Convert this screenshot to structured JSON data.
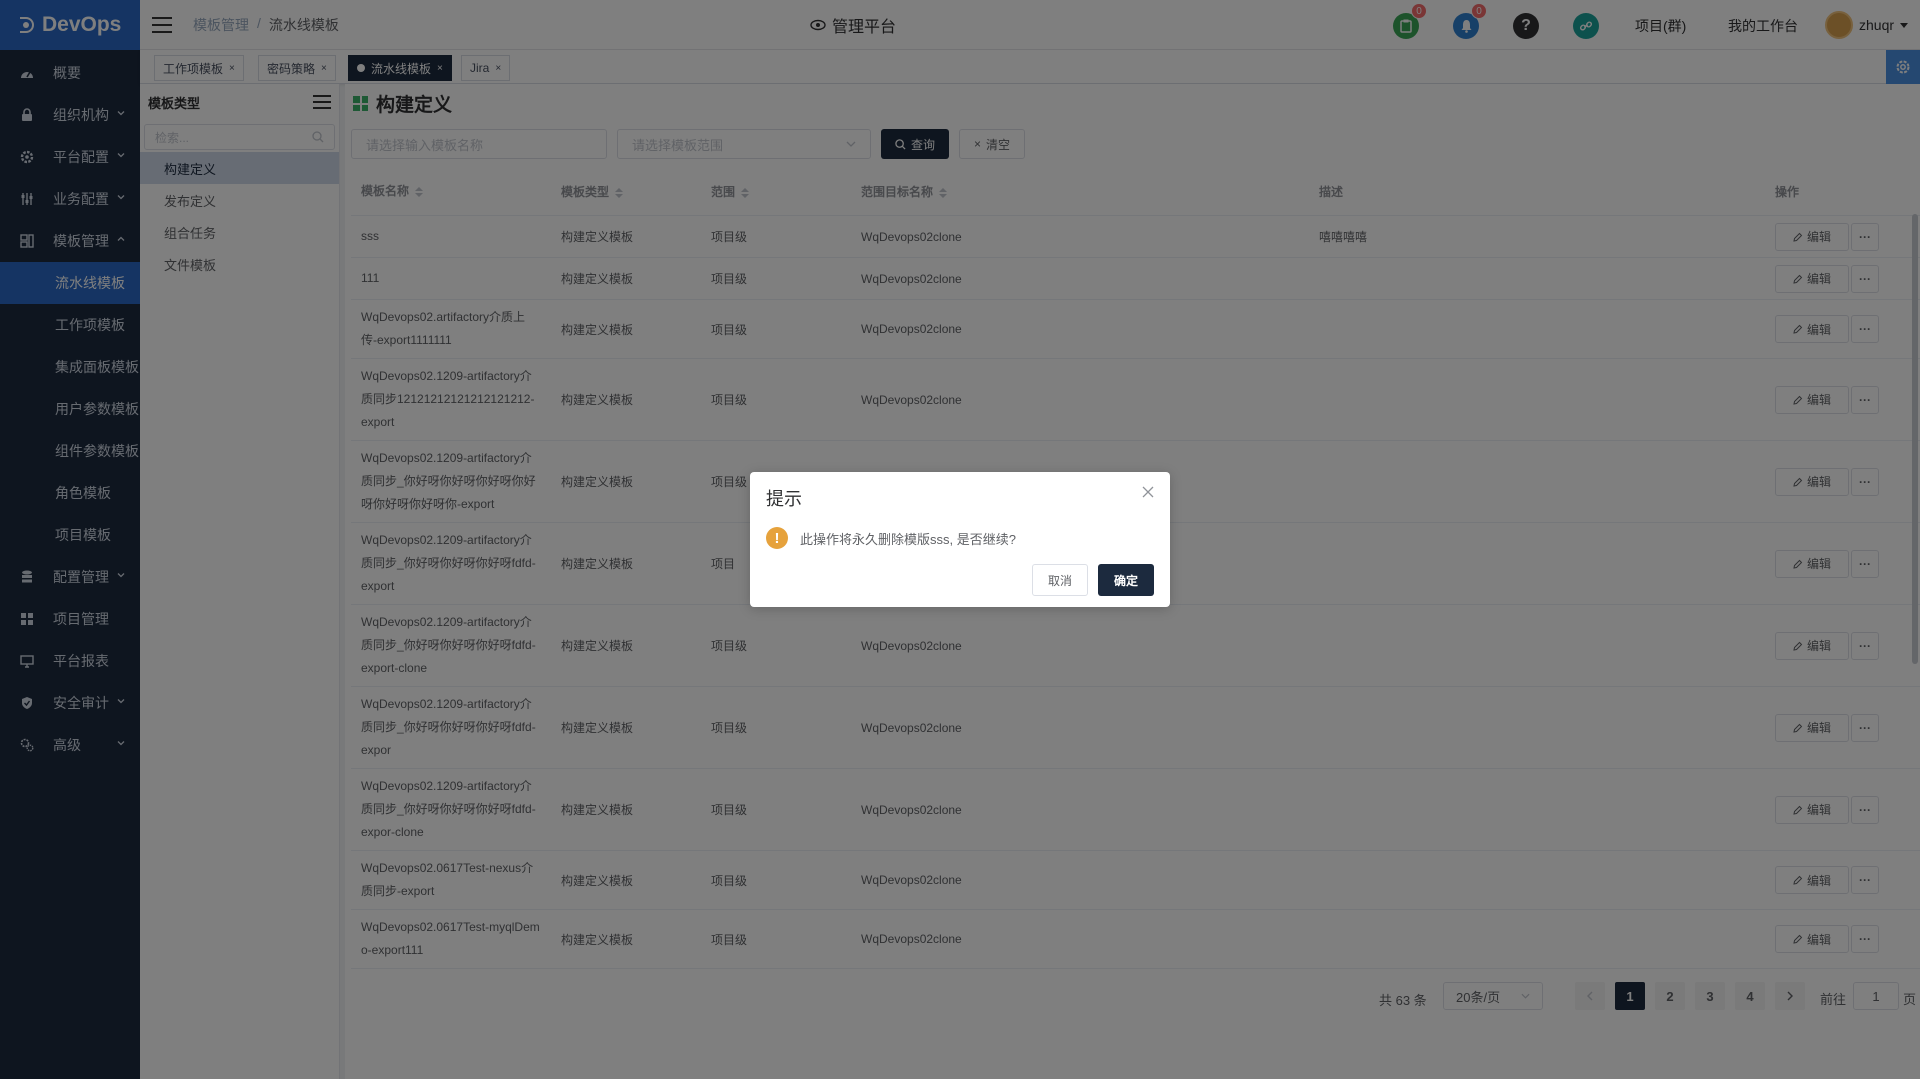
{
  "app": {
    "name": "DevOps"
  },
  "sidebar": {
    "items": [
      {
        "label": "概要",
        "icon": "dashboard-icon"
      },
      {
        "label": "组织机构",
        "icon": "lock-icon",
        "expandable": true
      },
      {
        "label": "平台配置",
        "icon": "gear-icon",
        "expandable": true
      },
      {
        "label": "业务配置",
        "icon": "sliders-icon",
        "expandable": true
      },
      {
        "label": "模板管理",
        "icon": "template-icon",
        "expanded": true
      },
      {
        "label": "配置管理",
        "icon": "database-icon",
        "expandable": true
      },
      {
        "label": "项目管理",
        "icon": "grid-icon"
      },
      {
        "label": "平台报表",
        "icon": "monitor-icon"
      },
      {
        "label": "安全审计",
        "icon": "shield-icon",
        "expandable": true
      },
      {
        "label": "高级",
        "icon": "advanced-icon",
        "expandable": true
      }
    ],
    "sub_items": [
      "流水线模板",
      "工作项模板",
      "集成面板模板",
      "用户参数模板",
      "组件参数模板",
      "角色模板",
      "项目模板"
    ]
  },
  "header": {
    "breadcrumb": [
      "模板管理",
      "流水线模板"
    ],
    "title": "管理平台",
    "badges": {
      "clipboard": "0",
      "bell": "0"
    },
    "links": {
      "project": "项目(群)",
      "workspace": "我的工作台"
    },
    "user": "zhuqr"
  },
  "tags": [
    {
      "label": "工作项模板"
    },
    {
      "label": "密码策略"
    },
    {
      "label": "流水线模板",
      "active": true
    },
    {
      "label": "Jira"
    }
  ],
  "type_panel": {
    "title": "模板类型",
    "search_placeholder": "检索...",
    "items": [
      "构建定义",
      "发布定义",
      "组合任务",
      "文件模板"
    ]
  },
  "main": {
    "title": "构建定义",
    "filters": {
      "name_placeholder": "请选择输入模板名称",
      "scope_placeholder": "请选择模板范围",
      "query": "查询",
      "clear": "清空"
    },
    "columns": [
      "模板名称",
      "模板类型",
      "范围",
      "范围目标名称",
      "描述",
      "操作"
    ],
    "edit_label": "编辑",
    "rows": [
      {
        "name": [
          "sss"
        ],
        "type": "构建定义模板",
        "scope": "项目级",
        "target": "WqDevops02clone",
        "desc": "嘻嘻嘻嘻"
      },
      {
        "name": [
          "111"
        ],
        "type": "构建定义模板",
        "scope": "项目级",
        "target": "WqDevops02clone",
        "desc": ""
      },
      {
        "name": [
          "WqDevops02.artifactory介质上",
          "传-export1111111"
        ],
        "type": "构建定义模板",
        "scope": "项目级",
        "target": "WqDevops02clone",
        "desc": ""
      },
      {
        "name": [
          "WqDevops02.1209-artifactory介",
          "质同步12121212121212121212-",
          "export"
        ],
        "type": "构建定义模板",
        "scope": "项目级",
        "target": "WqDevops02clone",
        "desc": ""
      },
      {
        "name": [
          "WqDevops02.1209-artifactory介",
          "质同步_你好呀你好呀你好呀你好",
          "呀你好呀你好呀你-export"
        ],
        "type": "构建定义模板",
        "scope": "项目级",
        "target": "",
        "desc": ""
      },
      {
        "name": [
          "WqDevops02.1209-artifactory介",
          "质同步_你好呀你好呀你好呀fdfd-",
          "export"
        ],
        "type": "构建定义模板",
        "scope": "项目",
        "target": "",
        "desc": ""
      },
      {
        "name": [
          "WqDevops02.1209-artifactory介",
          "质同步_你好呀你好呀你好呀fdfd-",
          "export-clone"
        ],
        "type": "构建定义模板",
        "scope": "项目级",
        "target": "WqDevops02clone",
        "desc": ""
      },
      {
        "name": [
          "WqDevops02.1209-artifactory介",
          "质同步_你好呀你好呀你好呀fdfd-",
          "expor"
        ],
        "type": "构建定义模板",
        "scope": "项目级",
        "target": "WqDevops02clone",
        "desc": ""
      },
      {
        "name": [
          "WqDevops02.1209-artifactory介",
          "质同步_你好呀你好呀你好呀fdfd-",
          "expor-clone"
        ],
        "type": "构建定义模板",
        "scope": "项目级",
        "target": "WqDevops02clone",
        "desc": ""
      },
      {
        "name": [
          "WqDevops02.0617Test-nexus介",
          "质同步-export"
        ],
        "type": "构建定义模板",
        "scope": "项目级",
        "target": "WqDevops02clone",
        "desc": ""
      },
      {
        "name": [
          "WqDevops02.0617Test-myqlDem",
          "o-export111"
        ],
        "type": "构建定义模板",
        "scope": "项目级",
        "target": "WqDevops02clone",
        "desc": ""
      }
    ]
  },
  "pagination": {
    "total": "共 63 条",
    "page_size": "20条/页",
    "pages": [
      "1",
      "2",
      "3",
      "4"
    ],
    "current": "1",
    "goto_label": "前往",
    "goto_value": "1",
    "goto_unit": "页"
  },
  "dialog": {
    "title": "提示",
    "message": "此操作将永久删除模版sss, 是否继续?",
    "cancel": "取消",
    "confirm": "确定"
  },
  "colors": {
    "sidebar_bg": "#1c2a3e",
    "brand_blue": "#2a69c7",
    "primary_dark": "#1c2a3e",
    "warning": "#e6a23c",
    "badge_red": "#f56c6c"
  }
}
